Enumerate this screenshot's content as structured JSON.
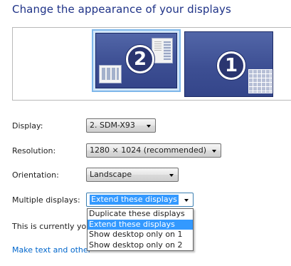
{
  "page": {
    "title": "Change the appearance of your displays"
  },
  "monitors": [
    {
      "number": "2",
      "selected": true
    },
    {
      "number": "1",
      "selected": false
    }
  ],
  "settings": {
    "display": {
      "label": "Display:",
      "value": "2. SDM-X93"
    },
    "resolution": {
      "label": "Resolution:",
      "value": "1280 × 1024 (recommended)"
    },
    "orientation": {
      "label": "Orientation:",
      "value": "Landscape"
    },
    "multiple_displays": {
      "label": "Multiple displays:",
      "value": "Extend these displays"
    }
  },
  "status": {
    "text": "This is currently you"
  },
  "link": {
    "text": "Make text and other"
  },
  "dropdown": {
    "items": [
      "Duplicate these displays",
      "Extend these displays",
      "Show desktop only on 1",
      "Show desktop only on 2"
    ],
    "selected": "Extend these displays"
  },
  "icons": {
    "combo_arrow": "chevron-down-icon",
    "taskbar_window": "window-thumbnail-icon",
    "start_grid": "grid-icon"
  },
  "colors": {
    "title": "#1e3287",
    "link": "#0066cc",
    "selection": "#3399ff",
    "monitor": "#3d4f93",
    "monitor_highlight": "#7fb7ea"
  }
}
